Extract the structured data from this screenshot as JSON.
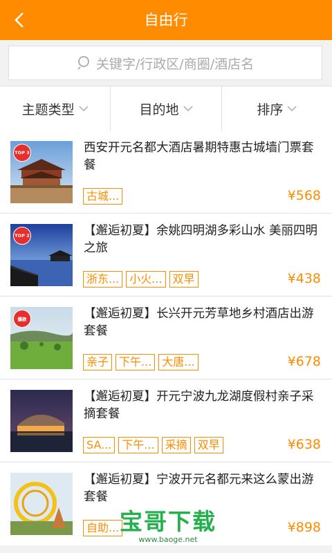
{
  "header": {
    "title": "自由行",
    "back_icon": "chevron-left-icon"
  },
  "search": {
    "placeholder": "关键字/行政区/商圈/酒店名",
    "icon": "search-icon"
  },
  "filters": [
    {
      "label": "主题类型"
    },
    {
      "label": "目的地"
    },
    {
      "label": "排序"
    }
  ],
  "items": [
    {
      "badge": "TOP 3",
      "name": "西安开元名都大酒店暑期特惠古城墙门票套餐",
      "tags": [
        "古城..."
      ],
      "price": "¥568"
    },
    {
      "badge": "TOP 2",
      "name": "【邂逅初夏】余姚四明湖多彩山水 美丽四明之旅",
      "tags": [
        "浙东...",
        "小火...",
        "双早"
      ],
      "price": "¥438"
    },
    {
      "badge": "爆款",
      "name": "【邂逅初夏】长兴开元芳草地乡村酒店出游套餐",
      "tags": [
        "亲子",
        "下午...",
        "大唐..."
      ],
      "price": "¥678"
    },
    {
      "badge": "",
      "name": "【邂逅初夏】开元宁波九龙湖度假村亲子采摘套餐",
      "tags": [
        "SA...",
        "下午...",
        "采摘",
        "双早"
      ],
      "price": "¥638"
    },
    {
      "badge": "",
      "name": "【邂逅初夏】宁波开元名都元来这么蒙出游套餐",
      "tags": [
        "自助..."
      ],
      "price": "¥898"
    }
  ],
  "watermark": {
    "brand": "宝哥下载",
    "url": "www.baoge.net"
  },
  "colors": {
    "accent": "#ff8c00",
    "background": "#f2f2f2"
  }
}
